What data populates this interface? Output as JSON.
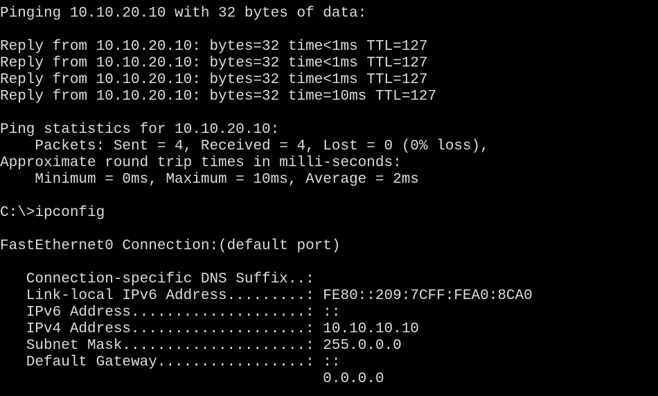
{
  "terminal": {
    "colors": {
      "background": "#000000",
      "foreground": "#dcdcdc"
    },
    "lines": [
      "Pinging 10.10.20.10 with 32 bytes of data:",
      "",
      "Reply from 10.10.20.10: bytes=32 time<1ms TTL=127",
      "Reply from 10.10.20.10: bytes=32 time<1ms TTL=127",
      "Reply from 10.10.20.10: bytes=32 time<1ms TTL=127",
      "Reply from 10.10.20.10: bytes=32 time=10ms TTL=127",
      "",
      "Ping statistics for 10.10.20.10:",
      "    Packets: Sent = 4, Received = 4, Lost = 0 (0% loss),",
      "Approximate round trip times in milli-seconds:",
      "    Minimum = 0ms, Maximum = 10ms, Average = 2ms",
      "",
      "C:\\>ipconfig",
      "",
      "FastEthernet0 Connection:(default port)",
      "",
      "   Connection-specific DNS Suffix..:",
      "   Link-local IPv6 Address.........: FE80::209:7CFF:FEA0:8CA0",
      "   IPv6 Address....................: ::",
      "   IPv4 Address....................: 10.10.10.10",
      "   Subnet Mask.....................: 255.0.0.0",
      "   Default Gateway.................: ::",
      "                                     0.0.0.0"
    ]
  }
}
